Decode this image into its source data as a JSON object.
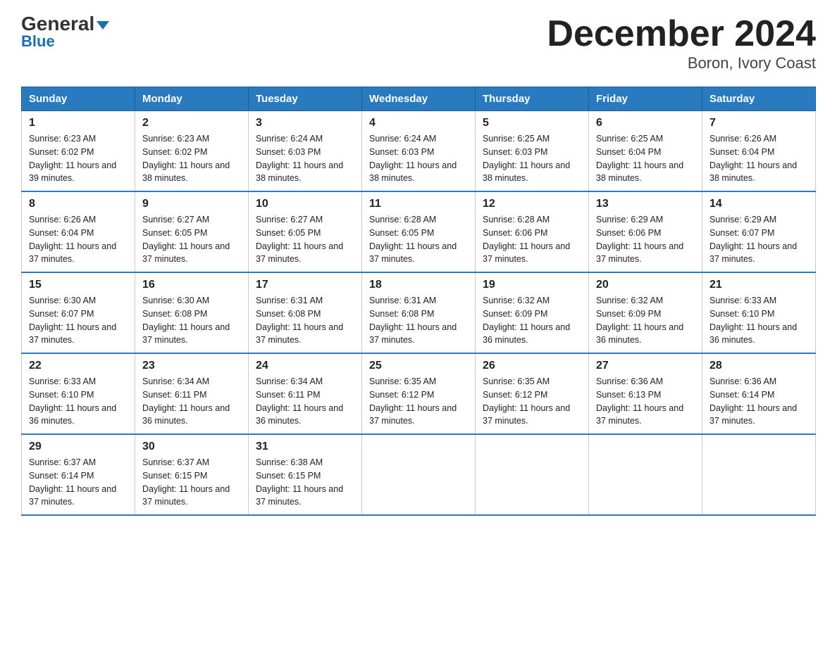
{
  "logo": {
    "general": "General",
    "blue": "Blue",
    "triangle": "▼"
  },
  "title": "December 2024",
  "subtitle": "Boron, Ivory Coast",
  "days_header": [
    "Sunday",
    "Monday",
    "Tuesday",
    "Wednesday",
    "Thursday",
    "Friday",
    "Saturday"
  ],
  "weeks": [
    [
      {
        "day": "1",
        "sunrise": "6:23 AM",
        "sunset": "6:02 PM",
        "daylight": "11 hours and 39 minutes."
      },
      {
        "day": "2",
        "sunrise": "6:23 AM",
        "sunset": "6:02 PM",
        "daylight": "11 hours and 38 minutes."
      },
      {
        "day": "3",
        "sunrise": "6:24 AM",
        "sunset": "6:03 PM",
        "daylight": "11 hours and 38 minutes."
      },
      {
        "day": "4",
        "sunrise": "6:24 AM",
        "sunset": "6:03 PM",
        "daylight": "11 hours and 38 minutes."
      },
      {
        "day": "5",
        "sunrise": "6:25 AM",
        "sunset": "6:03 PM",
        "daylight": "11 hours and 38 minutes."
      },
      {
        "day": "6",
        "sunrise": "6:25 AM",
        "sunset": "6:04 PM",
        "daylight": "11 hours and 38 minutes."
      },
      {
        "day": "7",
        "sunrise": "6:26 AM",
        "sunset": "6:04 PM",
        "daylight": "11 hours and 38 minutes."
      }
    ],
    [
      {
        "day": "8",
        "sunrise": "6:26 AM",
        "sunset": "6:04 PM",
        "daylight": "11 hours and 37 minutes."
      },
      {
        "day": "9",
        "sunrise": "6:27 AM",
        "sunset": "6:05 PM",
        "daylight": "11 hours and 37 minutes."
      },
      {
        "day": "10",
        "sunrise": "6:27 AM",
        "sunset": "6:05 PM",
        "daylight": "11 hours and 37 minutes."
      },
      {
        "day": "11",
        "sunrise": "6:28 AM",
        "sunset": "6:05 PM",
        "daylight": "11 hours and 37 minutes."
      },
      {
        "day": "12",
        "sunrise": "6:28 AM",
        "sunset": "6:06 PM",
        "daylight": "11 hours and 37 minutes."
      },
      {
        "day": "13",
        "sunrise": "6:29 AM",
        "sunset": "6:06 PM",
        "daylight": "11 hours and 37 minutes."
      },
      {
        "day": "14",
        "sunrise": "6:29 AM",
        "sunset": "6:07 PM",
        "daylight": "11 hours and 37 minutes."
      }
    ],
    [
      {
        "day": "15",
        "sunrise": "6:30 AM",
        "sunset": "6:07 PM",
        "daylight": "11 hours and 37 minutes."
      },
      {
        "day": "16",
        "sunrise": "6:30 AM",
        "sunset": "6:08 PM",
        "daylight": "11 hours and 37 minutes."
      },
      {
        "day": "17",
        "sunrise": "6:31 AM",
        "sunset": "6:08 PM",
        "daylight": "11 hours and 37 minutes."
      },
      {
        "day": "18",
        "sunrise": "6:31 AM",
        "sunset": "6:08 PM",
        "daylight": "11 hours and 37 minutes."
      },
      {
        "day": "19",
        "sunrise": "6:32 AM",
        "sunset": "6:09 PM",
        "daylight": "11 hours and 36 minutes."
      },
      {
        "day": "20",
        "sunrise": "6:32 AM",
        "sunset": "6:09 PM",
        "daylight": "11 hours and 36 minutes."
      },
      {
        "day": "21",
        "sunrise": "6:33 AM",
        "sunset": "6:10 PM",
        "daylight": "11 hours and 36 minutes."
      }
    ],
    [
      {
        "day": "22",
        "sunrise": "6:33 AM",
        "sunset": "6:10 PM",
        "daylight": "11 hours and 36 minutes."
      },
      {
        "day": "23",
        "sunrise": "6:34 AM",
        "sunset": "6:11 PM",
        "daylight": "11 hours and 36 minutes."
      },
      {
        "day": "24",
        "sunrise": "6:34 AM",
        "sunset": "6:11 PM",
        "daylight": "11 hours and 36 minutes."
      },
      {
        "day": "25",
        "sunrise": "6:35 AM",
        "sunset": "6:12 PM",
        "daylight": "11 hours and 37 minutes."
      },
      {
        "day": "26",
        "sunrise": "6:35 AM",
        "sunset": "6:12 PM",
        "daylight": "11 hours and 37 minutes."
      },
      {
        "day": "27",
        "sunrise": "6:36 AM",
        "sunset": "6:13 PM",
        "daylight": "11 hours and 37 minutes."
      },
      {
        "day": "28",
        "sunrise": "6:36 AM",
        "sunset": "6:14 PM",
        "daylight": "11 hours and 37 minutes."
      }
    ],
    [
      {
        "day": "29",
        "sunrise": "6:37 AM",
        "sunset": "6:14 PM",
        "daylight": "11 hours and 37 minutes."
      },
      {
        "day": "30",
        "sunrise": "6:37 AM",
        "sunset": "6:15 PM",
        "daylight": "11 hours and 37 minutes."
      },
      {
        "day": "31",
        "sunrise": "6:38 AM",
        "sunset": "6:15 PM",
        "daylight": "11 hours and 37 minutes."
      },
      null,
      null,
      null,
      null
    ]
  ]
}
